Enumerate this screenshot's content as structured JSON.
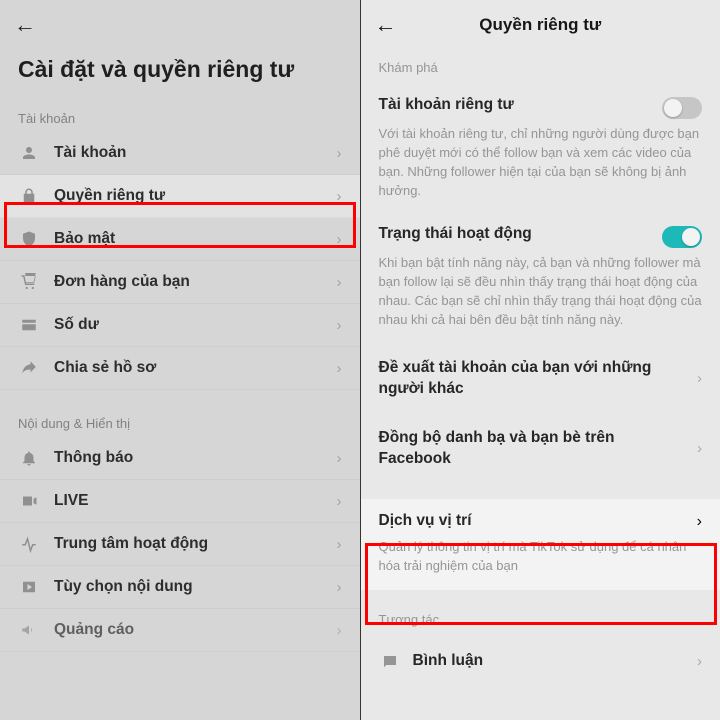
{
  "left": {
    "title": "Cài đặt và quyền riêng tư",
    "section_account": "Tài khoản",
    "section_content": "Nội dung & Hiển thị",
    "rows": {
      "account": "Tài khoản",
      "privacy": "Quyền riêng tư",
      "security": "Bảo mật",
      "orders": "Đơn hàng của bạn",
      "balance": "Số dư",
      "share": "Chia sẻ hồ sơ",
      "notifications": "Thông báo",
      "live": "LIVE",
      "activity": "Trung tâm hoạt động",
      "content_pref": "Tùy chọn nội dung",
      "ads": "Quảng cáo"
    }
  },
  "right": {
    "title": "Quyền riêng tư",
    "section_discover": "Khám phá",
    "private_account": {
      "title": "Tài khoản riêng tư",
      "desc": "Với tài khoản riêng tư, chỉ những người dùng được bạn phê duyệt mới có thể follow bạn và xem các video của bạn. Những follower hiện tại của bạn sẽ không bị ảnh hưởng."
    },
    "activity_status": {
      "title": "Trạng thái hoạt động",
      "desc": "Khi bạn bật tính năng này, cả bạn và những follower mà bạn follow lại sẽ đều nhìn thấy trạng thái hoạt động của nhau. Các bạn sẽ chỉ nhìn thấy trạng thái hoạt động của nhau khi cả hai bên đều bật tính năng này."
    },
    "suggest": "Đề xuất tài khoản của bạn với những người khác",
    "sync": "Đồng bộ danh bạ và bạn bè trên Facebook",
    "location": {
      "title": "Dịch vụ vị trí",
      "desc": "Quản lý thông tin vị trí mà TikTok sử dụng để cá nhân hóa trải nghiệm của bạn"
    },
    "section_interact": "Tương tác",
    "comments": "Bình luận"
  }
}
